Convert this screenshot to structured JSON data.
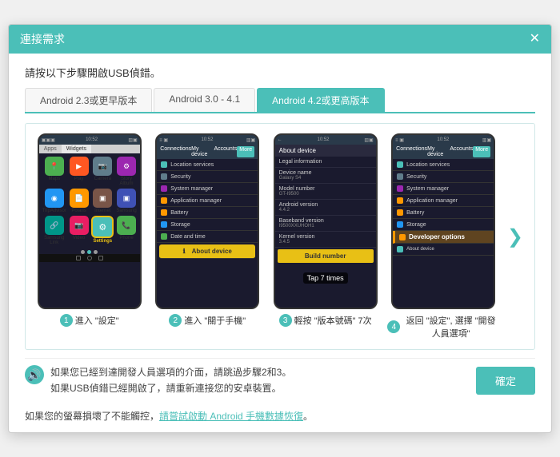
{
  "dialog": {
    "title": "連接需求",
    "close_label": "✕",
    "subtitle": "請按以下步驟開啟USB偵錯。"
  },
  "tabs": [
    {
      "label": "Android 2.3或更早版本",
      "active": false
    },
    {
      "label": "Android 3.0 - 4.1",
      "active": false
    },
    {
      "label": "Android 4.2或更高版本",
      "active": true
    }
  ],
  "steps": [
    {
      "num": "1",
      "label": "進入 \"設定\""
    },
    {
      "num": "2",
      "label": "進入 \"關于手機\""
    },
    {
      "num": "3",
      "label": "輕按 \"版本號碼\" 7次"
    },
    {
      "num": "4",
      "label": "返回 \"設定\", 選擇 \"開發人員選項\""
    }
  ],
  "nav_arrow": "❯",
  "settings_items": [
    {
      "label": "Location services"
    },
    {
      "label": "Security"
    },
    {
      "label": "System manager"
    },
    {
      "label": "Application manager"
    },
    {
      "label": "Battery"
    },
    {
      "label": "Storage"
    },
    {
      "label": "Date and time"
    }
  ],
  "about_items": [
    {
      "title": "Legal information"
    },
    {
      "title": "Device name",
      "value": "Galaxy S4"
    },
    {
      "title": "Model number",
      "value": "GT-I9500"
    },
    {
      "title": "Android version",
      "value": "4.4.2"
    },
    {
      "title": "Baseband version",
      "value": "I9500XXUHOH1"
    },
    {
      "title": "Kernel version",
      "value": "3.4.5"
    }
  ],
  "tap_overlay": "Tap 7 times",
  "build_number_label": "Build number",
  "developer_options_label": "Developer options",
  "about_device_label": "About device",
  "info_text_line1": "如果您已經到達開發人員選項的介面，請跳過步驟2和3。",
  "info_text_line2": "如果USB偵錯已經開啟了，請重新連接您的安卓裝置。",
  "footer_text_prefix": "如果您的螢幕損壞了不能觸控，",
  "footer_link": "請嘗試啟動 Android 手機數據恢復",
  "footer_text_suffix": "。",
  "confirm_label": "確定"
}
